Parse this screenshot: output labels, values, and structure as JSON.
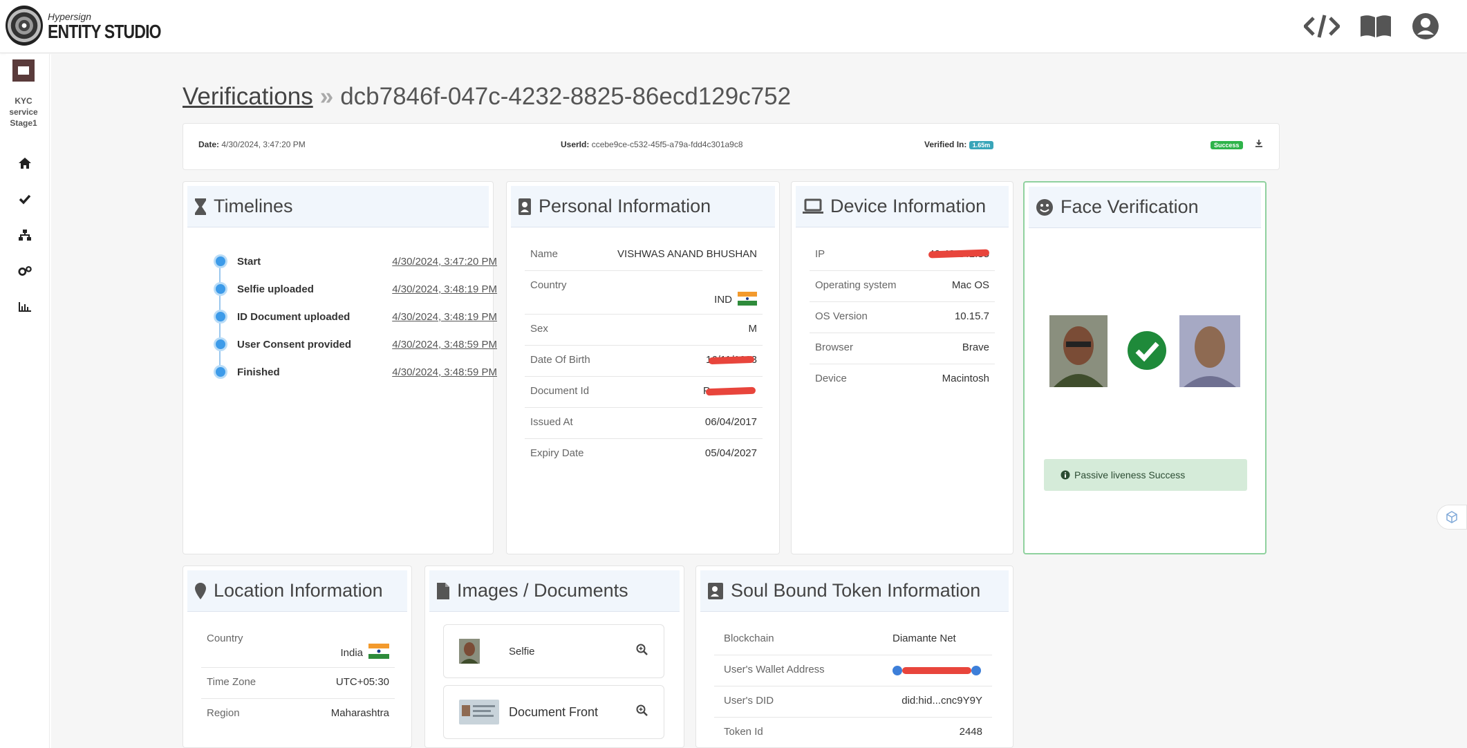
{
  "brand": {
    "small": "Hypersign",
    "big": "ENTITY STUDIO"
  },
  "top_icons": [
    "code-icon",
    "book-icon",
    "user-circle-icon"
  ],
  "sidebar": {
    "service_label": "KYC service Stage1",
    "items": [
      "home-icon",
      "check-icon",
      "sitemap-icon",
      "cogs-icon",
      "chart-icon"
    ]
  },
  "breadcrumb": {
    "parent": "Verifications",
    "separator": "»",
    "current": "dcb7846f-047c-4232-8825-86ecd129c752"
  },
  "meta": {
    "date_label": "Date:",
    "date_value": "4/30/2024, 3:47:20 PM",
    "userid_label": "UserId:",
    "userid_value": "ccebe9ce-c532-45f5-a79a-fdd4c301a9c8",
    "verified_label": "Verified In:",
    "verified_value": "1.65m",
    "status": "Success"
  },
  "timelines": {
    "title": "Timelines",
    "events": [
      {
        "label": "Start",
        "date": "4/30/2024, 3:47:20 PM"
      },
      {
        "label": "Selfie uploaded",
        "date": "4/30/2024, 3:48:19 PM"
      },
      {
        "label": "ID Document uploaded",
        "date": "4/30/2024, 3:48:19 PM"
      },
      {
        "label": "User Consent provided",
        "date": "4/30/2024, 3:48:59 PM"
      },
      {
        "label": "Finished",
        "date": "4/30/2024, 3:48:59 PM"
      }
    ]
  },
  "personal": {
    "title": "Personal Information",
    "rows": [
      {
        "key": "Name",
        "value": "VISHWAS ANAND BHUSHAN"
      },
      {
        "key": "Country",
        "value": "IND"
      },
      {
        "key": "Sex",
        "value": "M"
      },
      {
        "key": "Date Of Birth",
        "value": "16/11/1993"
      },
      {
        "key": "Document Id",
        "value": "P"
      },
      {
        "key": "Issued At",
        "value": "06/04/2017"
      },
      {
        "key": "Expiry Date",
        "value": "05/04/2027"
      }
    ]
  },
  "device": {
    "title": "Device Information",
    "rows": [
      {
        "key": "IP",
        "value": "49.43.241.85"
      },
      {
        "key": "Operating system",
        "value": "Mac OS"
      },
      {
        "key": "OS Version",
        "value": "10.15.7"
      },
      {
        "key": "Browser",
        "value": "Brave"
      },
      {
        "key": "Device",
        "value": "Macintosh"
      }
    ]
  },
  "face": {
    "title": "Face Verification",
    "liveness": "Passive liveness Success"
  },
  "location": {
    "title": "Location Information",
    "rows": [
      {
        "key": "Country",
        "value": "India"
      },
      {
        "key": "Time Zone",
        "value": "UTC+05:30"
      },
      {
        "key": "Region",
        "value": "Maharashtra"
      }
    ]
  },
  "images": {
    "title": "Images / Documents",
    "items": [
      {
        "label": "Selfie"
      },
      {
        "label": "Document Front"
      }
    ]
  },
  "sbt": {
    "title": "Soul Bound Token Information",
    "rows": [
      {
        "key": "Blockchain",
        "value": "Diamante Net"
      },
      {
        "key": "User's Wallet Address",
        "value": ""
      },
      {
        "key": "User's DID",
        "value": "did:hid...cnc9Y9Y"
      },
      {
        "key": "Token Id",
        "value": "2448"
      }
    ]
  },
  "colors": {
    "accent": "#3d9be9",
    "success": "#2fb34a",
    "header_bg": "#f1f6fc",
    "redaction": "#e8453c"
  }
}
